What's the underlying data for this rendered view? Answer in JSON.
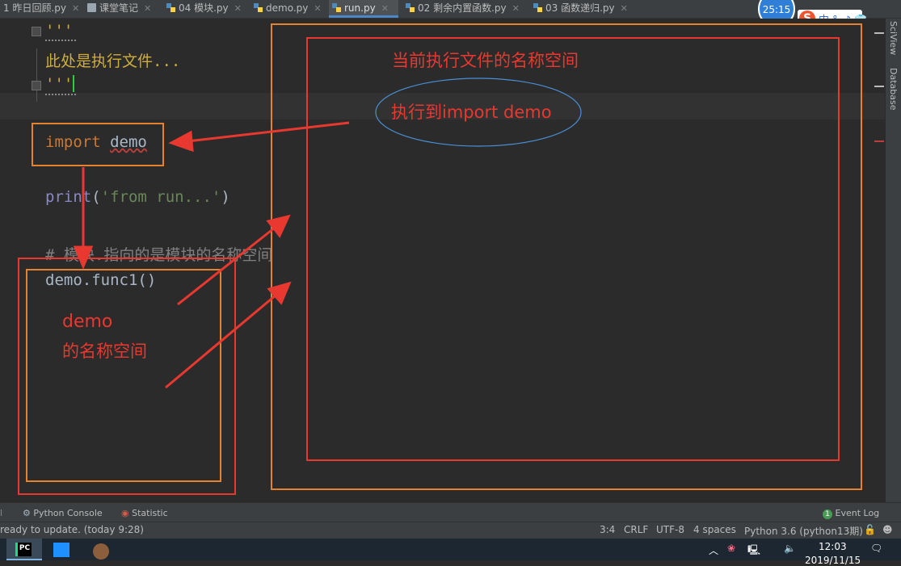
{
  "tabs": [
    {
      "label": "1 昨日回顾.py",
      "active": false
    },
    {
      "label": "课堂笔记",
      "active": false
    },
    {
      "label": "04 模块.py",
      "active": false
    },
    {
      "label": "demo.py",
      "active": false
    },
    {
      "label": "run.py",
      "active": true
    },
    {
      "label": "02 剩余内置函数.py",
      "active": false
    },
    {
      "label": "03 函数递归.py",
      "active": false
    }
  ],
  "timer": "25:15",
  "ime_logo_letter": "S",
  "ime_toolbar_glyphs": "中 °, ♪ 👕",
  "code": {
    "doc_open": "'''",
    "doc_text": "此处是执行文件...",
    "doc_close": "'''",
    "import_kw": "import",
    "import_mod": "demo",
    "print_fn": "print",
    "print_open": "(",
    "print_str": "'from run...'",
    "print_close": ")",
    "comment": "# 模块.指向的是模块的名称空间",
    "call": "demo.func1()"
  },
  "annotations": {
    "current_namespace": "当前执行文件的名称空间",
    "executing_import": "执行到import demo",
    "demo_namespace_line1": "demo",
    "demo_namespace_line2": "的名称空间"
  },
  "side_panels": [
    "SciView",
    "Database"
  ],
  "tool_windows": {
    "python_console": "Python Console",
    "statistic": "Statistic",
    "event_log": "Event Log",
    "event_log_count": "1"
  },
  "status": {
    "message": "ready to update. (today 9:28)",
    "position": "3:4",
    "line_sep": "CRLF",
    "encoding": "UTF-8",
    "indent": "4 spaces",
    "interpreter": "Python 3.6 (python13期)"
  },
  "taskbar": {
    "pycharm_label": "PC",
    "time": "12:03",
    "date": "2019/11/15"
  },
  "colors": {
    "annotation_red": "#e8382f",
    "annotation_orange": "#e5822f",
    "ellipse_blue": "#4a8fd6",
    "editor_bg": "#2b2b2b",
    "keyword": "#cc7832",
    "string": "#6a8759"
  }
}
